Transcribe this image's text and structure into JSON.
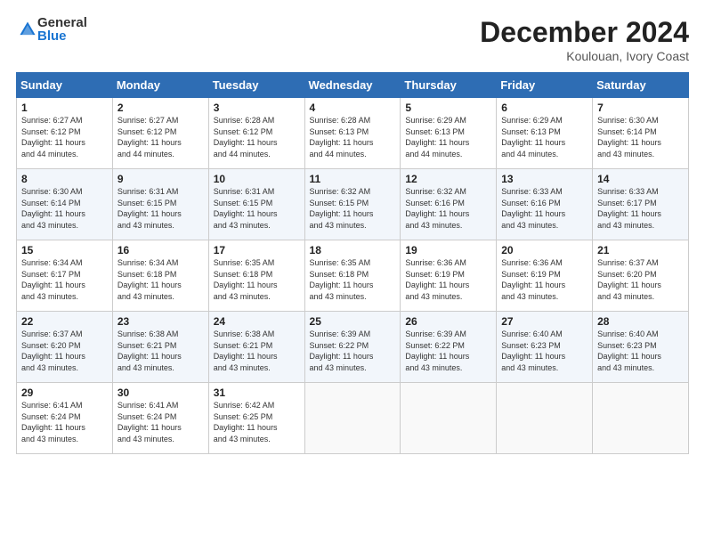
{
  "header": {
    "logo_general": "General",
    "logo_blue": "Blue",
    "month_year": "December 2024",
    "location": "Koulouan, Ivory Coast"
  },
  "weekdays": [
    "Sunday",
    "Monday",
    "Tuesday",
    "Wednesday",
    "Thursday",
    "Friday",
    "Saturday"
  ],
  "weeks": [
    [
      {
        "day": "1",
        "sunrise": "6:27 AM",
        "sunset": "6:12 PM",
        "daylight": "11 hours and 44 minutes."
      },
      {
        "day": "2",
        "sunrise": "6:27 AM",
        "sunset": "6:12 PM",
        "daylight": "11 hours and 44 minutes."
      },
      {
        "day": "3",
        "sunrise": "6:28 AM",
        "sunset": "6:12 PM",
        "daylight": "11 hours and 44 minutes."
      },
      {
        "day": "4",
        "sunrise": "6:28 AM",
        "sunset": "6:13 PM",
        "daylight": "11 hours and 44 minutes."
      },
      {
        "day": "5",
        "sunrise": "6:29 AM",
        "sunset": "6:13 PM",
        "daylight": "11 hours and 44 minutes."
      },
      {
        "day": "6",
        "sunrise": "6:29 AM",
        "sunset": "6:13 PM",
        "daylight": "11 hours and 44 minutes."
      },
      {
        "day": "7",
        "sunrise": "6:30 AM",
        "sunset": "6:14 PM",
        "daylight": "11 hours and 43 minutes."
      }
    ],
    [
      {
        "day": "8",
        "sunrise": "6:30 AM",
        "sunset": "6:14 PM",
        "daylight": "11 hours and 43 minutes."
      },
      {
        "day": "9",
        "sunrise": "6:31 AM",
        "sunset": "6:15 PM",
        "daylight": "11 hours and 43 minutes."
      },
      {
        "day": "10",
        "sunrise": "6:31 AM",
        "sunset": "6:15 PM",
        "daylight": "11 hours and 43 minutes."
      },
      {
        "day": "11",
        "sunrise": "6:32 AM",
        "sunset": "6:15 PM",
        "daylight": "11 hours and 43 minutes."
      },
      {
        "day": "12",
        "sunrise": "6:32 AM",
        "sunset": "6:16 PM",
        "daylight": "11 hours and 43 minutes."
      },
      {
        "day": "13",
        "sunrise": "6:33 AM",
        "sunset": "6:16 PM",
        "daylight": "11 hours and 43 minutes."
      },
      {
        "day": "14",
        "sunrise": "6:33 AM",
        "sunset": "6:17 PM",
        "daylight": "11 hours and 43 minutes."
      }
    ],
    [
      {
        "day": "15",
        "sunrise": "6:34 AM",
        "sunset": "6:17 PM",
        "daylight": "11 hours and 43 minutes."
      },
      {
        "day": "16",
        "sunrise": "6:34 AM",
        "sunset": "6:18 PM",
        "daylight": "11 hours and 43 minutes."
      },
      {
        "day": "17",
        "sunrise": "6:35 AM",
        "sunset": "6:18 PM",
        "daylight": "11 hours and 43 minutes."
      },
      {
        "day": "18",
        "sunrise": "6:35 AM",
        "sunset": "6:18 PM",
        "daylight": "11 hours and 43 minutes."
      },
      {
        "day": "19",
        "sunrise": "6:36 AM",
        "sunset": "6:19 PM",
        "daylight": "11 hours and 43 minutes."
      },
      {
        "day": "20",
        "sunrise": "6:36 AM",
        "sunset": "6:19 PM",
        "daylight": "11 hours and 43 minutes."
      },
      {
        "day": "21",
        "sunrise": "6:37 AM",
        "sunset": "6:20 PM",
        "daylight": "11 hours and 43 minutes."
      }
    ],
    [
      {
        "day": "22",
        "sunrise": "6:37 AM",
        "sunset": "6:20 PM",
        "daylight": "11 hours and 43 minutes."
      },
      {
        "day": "23",
        "sunrise": "6:38 AM",
        "sunset": "6:21 PM",
        "daylight": "11 hours and 43 minutes."
      },
      {
        "day": "24",
        "sunrise": "6:38 AM",
        "sunset": "6:21 PM",
        "daylight": "11 hours and 43 minutes."
      },
      {
        "day": "25",
        "sunrise": "6:39 AM",
        "sunset": "6:22 PM",
        "daylight": "11 hours and 43 minutes."
      },
      {
        "day": "26",
        "sunrise": "6:39 AM",
        "sunset": "6:22 PM",
        "daylight": "11 hours and 43 minutes."
      },
      {
        "day": "27",
        "sunrise": "6:40 AM",
        "sunset": "6:23 PM",
        "daylight": "11 hours and 43 minutes."
      },
      {
        "day": "28",
        "sunrise": "6:40 AM",
        "sunset": "6:23 PM",
        "daylight": "11 hours and 43 minutes."
      }
    ],
    [
      {
        "day": "29",
        "sunrise": "6:41 AM",
        "sunset": "6:24 PM",
        "daylight": "11 hours and 43 minutes."
      },
      {
        "day": "30",
        "sunrise": "6:41 AM",
        "sunset": "6:24 PM",
        "daylight": "11 hours and 43 minutes."
      },
      {
        "day": "31",
        "sunrise": "6:42 AM",
        "sunset": "6:25 PM",
        "daylight": "11 hours and 43 minutes."
      },
      null,
      null,
      null,
      null
    ]
  ],
  "labels": {
    "sunrise": "Sunrise:",
    "sunset": "Sunset:",
    "daylight": "Daylight:"
  }
}
